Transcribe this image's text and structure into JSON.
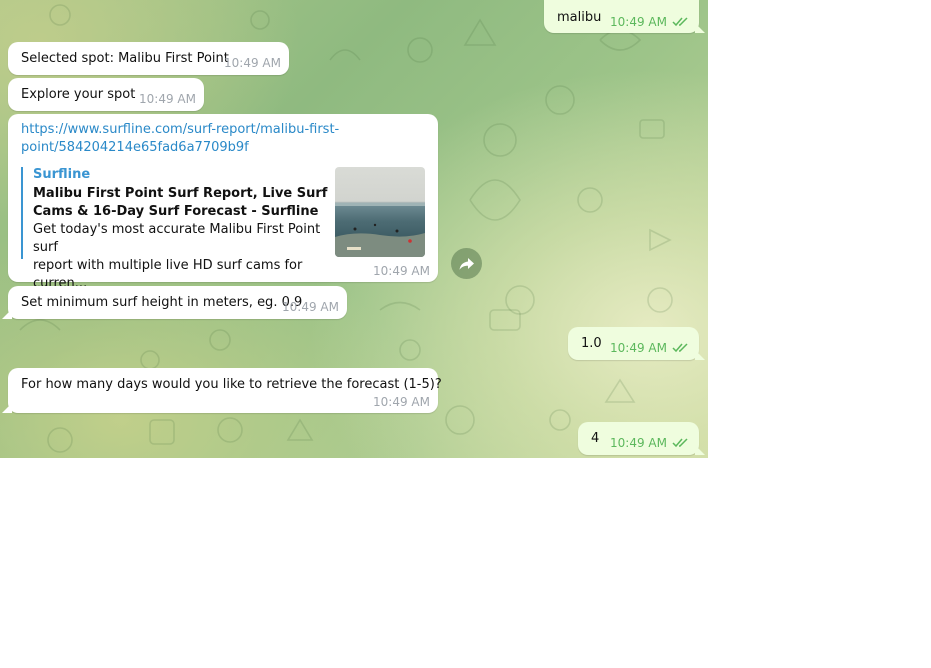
{
  "messages": {
    "m1": {
      "text": "malibu",
      "time": "10:49 AM"
    },
    "m2": {
      "text": "Selected spot: Malibu First Point",
      "time": "10:49 AM"
    },
    "m3": {
      "text": "Explore your spot",
      "time": "10:49 AM"
    },
    "m4": {
      "link_line1": "https://www.surfline.com/surf-report/malibu-first-",
      "link_line2": "point/584204214e65fad6a7709b9f",
      "preview_site": "Surfline",
      "preview_title": "Malibu First Point Surf Report, Live Surf Cams & 16-Day Surf Forecast - Surfline",
      "preview_desc_line1": "Get today's most accurate Malibu First Point surf",
      "preview_desc_line2": "report with multiple live HD surf cams for curren...",
      "time": "10:49 AM"
    },
    "m5": {
      "text": "Set minimum surf height in meters, eg. 0.9",
      "time": "10:49 AM"
    },
    "m6": {
      "text": "1.0",
      "time": "10:49 AM"
    },
    "m7": {
      "text": "For how many days would you like to retrieve the forecast (1-5)?",
      "time": "10:49 AM"
    },
    "m8": {
      "text": "4",
      "time": "10:49 AM"
    }
  },
  "icons": {
    "read_receipt": "double-check-icon",
    "share": "share-arrow-icon"
  },
  "colors": {
    "outgoing_bubble": "#effdde",
    "incoming_bubble": "#ffffff",
    "link": "#2a89c8",
    "read_check": "#5cb85c"
  }
}
